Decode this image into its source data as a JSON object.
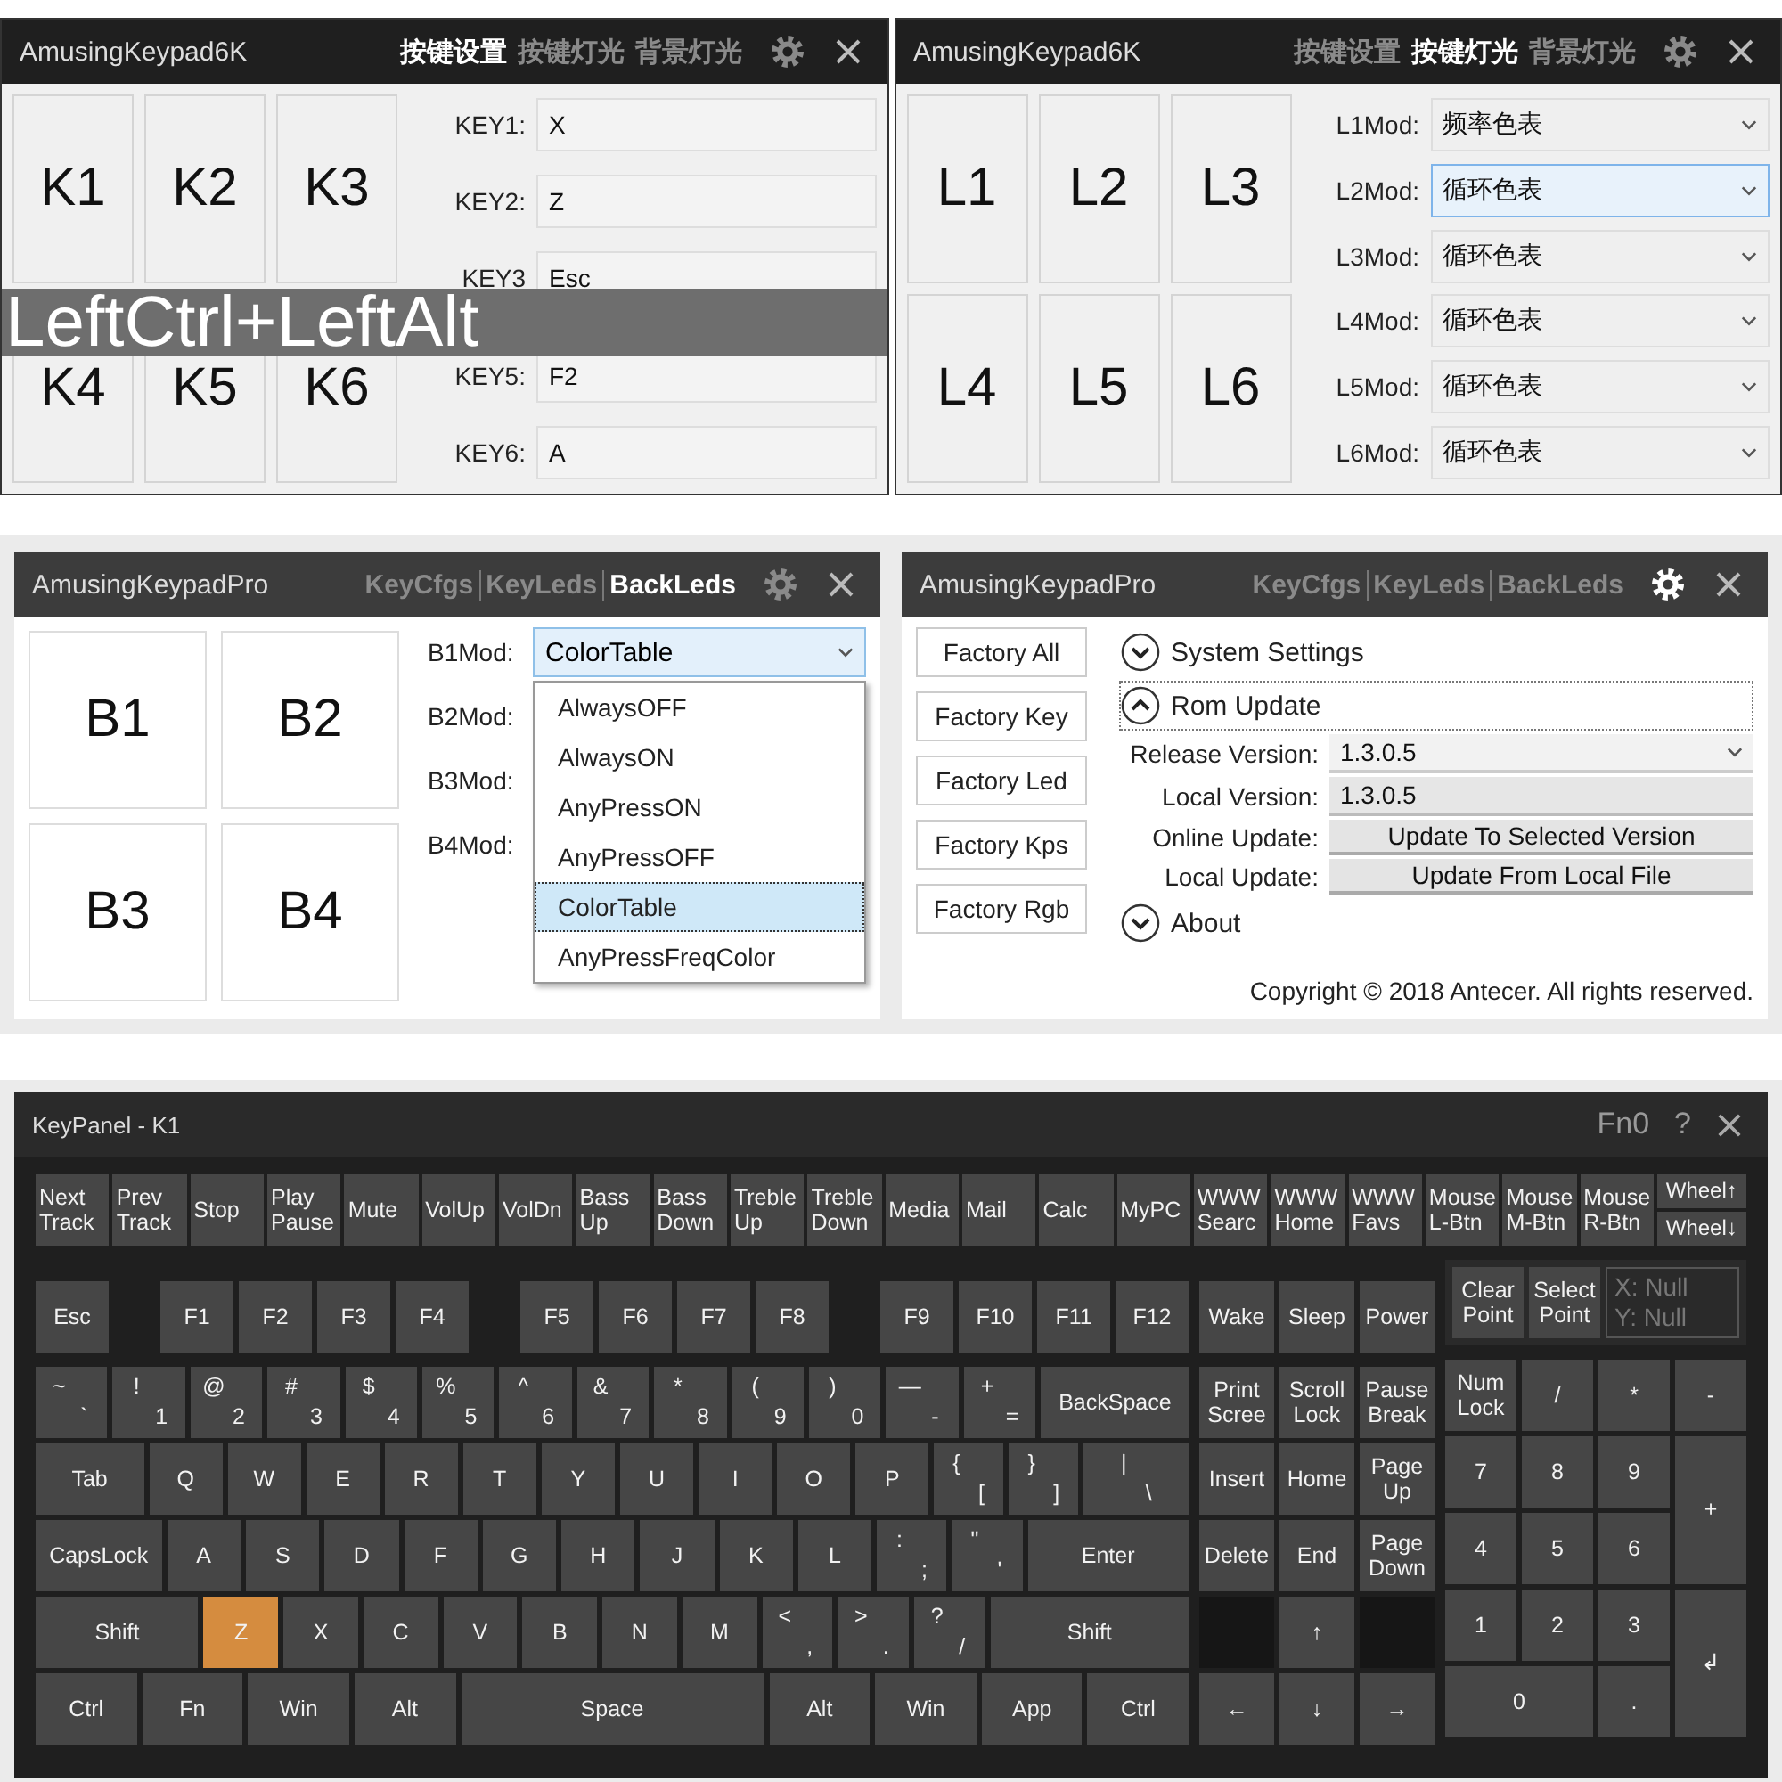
{
  "key_window": {
    "title": "AmusingKeypad6K",
    "settings_selected": false,
    "tabs": [
      {
        "label": "按键设置",
        "selected": true
      },
      {
        "label": "按键灯光",
        "selected": false
      },
      {
        "label": "背景灯光",
        "selected": false
      }
    ],
    "tiles": [
      "K1",
      "K2",
      "K3",
      "K4",
      "K5",
      "K6"
    ],
    "keys": [
      {
        "label": "KEY1:",
        "value": "X"
      },
      {
        "label": "KEY2:",
        "value": "Z"
      },
      {
        "label": "KEY3",
        "value": "Esc"
      },
      {
        "label": "KEY5:",
        "value": "F2"
      },
      {
        "label": "KEY6:",
        "value": "A"
      }
    ],
    "overlay": "LeftCtrl+LeftAlt"
  },
  "led_window": {
    "title": "AmusingKeypad6K",
    "settings_selected": false,
    "tabs": [
      {
        "label": "按键设置",
        "selected": false
      },
      {
        "label": "按键灯光",
        "selected": true
      },
      {
        "label": "背景灯光",
        "selected": false
      }
    ],
    "tiles": [
      "L1",
      "L2",
      "L3",
      "L4",
      "L5",
      "L6"
    ],
    "mods": [
      {
        "label": "L1Mod:",
        "value": "频率色表",
        "focused": false
      },
      {
        "label": "L2Mod:",
        "value": "循环色表",
        "focused": true
      },
      {
        "label": "L3Mod:",
        "value": "循环色表",
        "focused": false
      },
      {
        "label": "L4Mod:",
        "value": "循环色表",
        "focused": false
      },
      {
        "label": "L5Mod:",
        "value": "循环色表",
        "focused": false
      },
      {
        "label": "L6Mod:",
        "value": "循环色表",
        "focused": false
      }
    ]
  },
  "backled_window": {
    "title": "AmusingKeypadPro",
    "settings_selected": false,
    "tabs": [
      {
        "label": "KeyCfgs",
        "selected": false
      },
      {
        "label": "KeyLeds",
        "selected": false
      },
      {
        "label": "BackLeds",
        "selected": true
      }
    ],
    "tiles": [
      "B1",
      "B2",
      "B3",
      "B4"
    ],
    "mods": [
      {
        "label": "B1Mod:",
        "value": "ColorTable"
      },
      {
        "label": "B2Mod:"
      },
      {
        "label": "B3Mod:"
      },
      {
        "label": "B4Mod:"
      }
    ],
    "dropdown": [
      {
        "label": "AlwaysOFF",
        "selected": false
      },
      {
        "label": "AlwaysON",
        "selected": false
      },
      {
        "label": "AnyPressON",
        "selected": false
      },
      {
        "label": "AnyPressOFF",
        "selected": false
      },
      {
        "label": "ColorTable",
        "selected": true
      },
      {
        "label": "AnyPressFreqColor",
        "selected": false
      }
    ]
  },
  "settings_window": {
    "title": "AmusingKeypadPro",
    "settings_selected": true,
    "tabs": [
      {
        "label": "KeyCfgs",
        "selected": false
      },
      {
        "label": "KeyLeds",
        "selected": false
      },
      {
        "label": "BackLeds",
        "selected": false
      }
    ],
    "factory_buttons": [
      "Factory All",
      "Factory Key",
      "Factory Led",
      "Factory Kps",
      "Factory Rgb"
    ],
    "sections": [
      {
        "title": "System Settings",
        "expanded": false,
        "focused": false
      },
      {
        "title": "Rom Update",
        "expanded": true,
        "focused": true,
        "rows": [
          {
            "kind": "select",
            "label": "Release Version:",
            "value": "1.3.0.5"
          },
          {
            "kind": "field",
            "label": "Local Version:",
            "value": "1.3.0.5"
          },
          {
            "kind": "button",
            "label": "Online Update:",
            "value": "Update To Selected Version"
          },
          {
            "kind": "button",
            "label": "Local Update:",
            "value": "Update From Local File"
          }
        ]
      },
      {
        "title": "About",
        "expanded": false,
        "focused": false
      }
    ],
    "copyright": "Copyright ©  2018 Antecer. All rights reserved."
  },
  "keyboard": {
    "title": "KeyPanel - K1",
    "fn_layer": "Fn0",
    "help": "?",
    "media_keys": [
      {
        "lines": [
          "Next",
          "Track"
        ]
      },
      {
        "lines": [
          "Prev",
          "Track"
        ]
      },
      {
        "lines": [
          "Stop"
        ]
      },
      {
        "lines": [
          "Play",
          "Pause"
        ]
      },
      {
        "lines": [
          "Mute"
        ]
      },
      {
        "lines": [
          "VolUp"
        ]
      },
      {
        "lines": [
          "VolDn"
        ]
      },
      {
        "lines": [
          "Bass",
          "Up"
        ]
      },
      {
        "lines": [
          "Bass",
          "Down"
        ]
      },
      {
        "lines": [
          "Treble",
          "Up"
        ]
      },
      {
        "lines": [
          "Treble",
          "Down"
        ]
      },
      {
        "lines": [
          "Media"
        ]
      },
      {
        "lines": [
          "Mail"
        ]
      },
      {
        "lines": [
          "Calc"
        ]
      },
      {
        "lines": [
          "MyPC"
        ]
      },
      {
        "lines": [
          "WWW",
          "Searc"
        ]
      },
      {
        "lines": [
          "WWW",
          "Home"
        ]
      },
      {
        "lines": [
          "WWW",
          "Favs"
        ]
      },
      {
        "lines": [
          "Mouse",
          "L-Btn"
        ]
      },
      {
        "lines": [
          "Mouse",
          "M-Btn"
        ]
      },
      {
        "lines": [
          "Mouse",
          "R-Btn"
        ]
      }
    ],
    "wheel_keys": [
      "Wheel↑",
      "Wheel↓"
    ],
    "f_groups": [
      {
        "keys": [
          {
            "label": "Esc",
            "selected": false
          }
        ]
      },
      {
        "keys": [
          {
            "label": "F1",
            "selected": false
          },
          {
            "label": "F2",
            "selected": false
          },
          {
            "label": "F3",
            "selected": false
          },
          {
            "label": "F4",
            "selected": false
          }
        ]
      },
      {
        "keys": [
          {
            "label": "F5",
            "selected": false
          },
          {
            "label": "F6",
            "selected": false
          },
          {
            "label": "F7",
            "selected": false
          },
          {
            "label": "F8",
            "selected": false
          }
        ]
      },
      {
        "keys": [
          {
            "label": "F9",
            "selected": false
          },
          {
            "label": "F10",
            "selected": false
          },
          {
            "label": "F11",
            "selected": false
          },
          {
            "label": "F12",
            "selected": false
          }
        ]
      }
    ],
    "main_rows": [
      {
        "keys": [
          {
            "upper": "~",
            "lower": "`",
            "selected": false
          },
          {
            "upper": "!",
            "lower": "1",
            "selected": false
          },
          {
            "upper": "@",
            "lower": "2",
            "selected": false
          },
          {
            "upper": "#",
            "lower": "3",
            "selected": false
          },
          {
            "upper": "$",
            "lower": "4",
            "selected": false
          },
          {
            "upper": "%",
            "lower": "5",
            "selected": false
          },
          {
            "upper": "^",
            "lower": "6",
            "selected": false
          },
          {
            "upper": "&",
            "lower": "7",
            "selected": false
          },
          {
            "upper": "*",
            "lower": "8",
            "selected": false
          },
          {
            "upper": "(",
            "lower": "9",
            "selected": false
          },
          {
            "upper": ")",
            "lower": "0",
            "selected": false
          },
          {
            "upper": "—",
            "lower": "-",
            "selected": false
          },
          {
            "upper": "+",
            "lower": "=",
            "selected": false
          },
          {
            "label": "BackSpace",
            "selected": false
          }
        ]
      },
      {
        "keys": [
          {
            "label": "Tab",
            "selected": false
          },
          {
            "label": "Q",
            "selected": false
          },
          {
            "label": "W",
            "selected": false
          },
          {
            "label": "E",
            "selected": false
          },
          {
            "label": "R",
            "selected": false
          },
          {
            "label": "T",
            "selected": false
          },
          {
            "label": "Y",
            "selected": false
          },
          {
            "label": "U",
            "selected": false
          },
          {
            "label": "I",
            "selected": false
          },
          {
            "label": "O",
            "selected": false
          },
          {
            "label": "P",
            "selected": false
          },
          {
            "upper": "{",
            "lower": "[",
            "selected": false
          },
          {
            "upper": "}",
            "lower": "]",
            "selected": false
          },
          {
            "upper": "|",
            "lower": "\\",
            "selected": false
          }
        ]
      },
      {
        "keys": [
          {
            "label": "CapsLock",
            "selected": false
          },
          {
            "label": "A",
            "selected": false
          },
          {
            "label": "S",
            "selected": false
          },
          {
            "label": "D",
            "selected": false
          },
          {
            "label": "F",
            "selected": false
          },
          {
            "label": "G",
            "selected": false
          },
          {
            "label": "H",
            "selected": false
          },
          {
            "label": "J",
            "selected": false
          },
          {
            "label": "K",
            "selected": false
          },
          {
            "label": "L",
            "selected": false
          },
          {
            "upper": ":",
            "lower": ";",
            "selected": false
          },
          {
            "upper": "\"",
            "lower": "'",
            "selected": false
          },
          {
            "label": "Enter",
            "selected": false
          }
        ]
      },
      {
        "keys": [
          {
            "label": "Shift",
            "selected": false
          },
          {
            "label": "Z",
            "selected": true
          },
          {
            "label": "X",
            "selected": false
          },
          {
            "label": "C",
            "selected": false
          },
          {
            "label": "V",
            "selected": false
          },
          {
            "label": "B",
            "selected": false
          },
          {
            "label": "N",
            "selected": false
          },
          {
            "label": "M",
            "selected": false
          },
          {
            "upper": "<",
            "lower": ",",
            "selected": false
          },
          {
            "upper": ">",
            "lower": ".",
            "selected": false
          },
          {
            "upper": "?",
            "lower": "/",
            "selected": false
          },
          {
            "label": "Shift",
            "selected": false
          }
        ]
      },
      {
        "keys": [
          {
            "label": "Ctrl",
            "selected": false
          },
          {
            "label": "Fn",
            "selected": false
          },
          {
            "label": "Win",
            "selected": false
          },
          {
            "label": "Alt",
            "selected": false
          },
          {
            "label": "Space",
            "selected": false
          },
          {
            "label": "Alt",
            "selected": false
          },
          {
            "label": "Win",
            "selected": false
          },
          {
            "label": "App",
            "selected": false
          },
          {
            "label": "Ctrl",
            "selected": false
          }
        ]
      }
    ],
    "nav_top": [
      {
        "label": "Wake",
        "selected": false
      },
      {
        "label": "Sleep",
        "selected": false
      },
      {
        "label": "Power",
        "selected": false
      }
    ],
    "nav_keys": [
      {
        "kind": "key",
        "lines": [
          "Print",
          "Scree"
        ],
        "selected": false
      },
      {
        "kind": "key",
        "lines": [
          "Scroll",
          "Lock"
        ],
        "selected": false
      },
      {
        "kind": "key",
        "lines": [
          "Pause",
          "Break"
        ],
        "selected": false
      },
      {
        "kind": "key",
        "lines": [
          "Insert"
        ],
        "selected": false
      },
      {
        "kind": "key",
        "lines": [
          "Home"
        ],
        "selected": false
      },
      {
        "kind": "key",
        "lines": [
          "Page",
          "Up"
        ],
        "selected": false
      },
      {
        "kind": "key",
        "lines": [
          "Delete"
        ],
        "selected": false
      },
      {
        "kind": "key",
        "lines": [
          "End"
        ],
        "selected": false
      },
      {
        "kind": "key",
        "lines": [
          "Page",
          "Down"
        ],
        "selected": false
      },
      {
        "kind": "blank"
      },
      {
        "kind": "key",
        "lines": [
          "↑"
        ],
        "selected": false
      },
      {
        "kind": "blank"
      },
      {
        "kind": "key",
        "lines": [
          "←"
        ],
        "selected": false
      },
      {
        "kind": "key",
        "lines": [
          "↓"
        ],
        "selected": false
      },
      {
        "kind": "key",
        "lines": [
          "→"
        ],
        "selected": false
      }
    ],
    "point_buttons": [
      {
        "lines": [
          "Clear",
          "Point"
        ]
      },
      {
        "lines": [
          "Select",
          "Point"
        ]
      }
    ],
    "coords": [
      "X: Null",
      "Y: Null"
    ],
    "numpad": [
      {
        "kind": "key",
        "lines": [
          "Num",
          "Lock"
        ],
        "selected": false
      },
      {
        "kind": "key",
        "lines": [
          "/"
        ],
        "selected": false
      },
      {
        "kind": "key",
        "lines": [
          "*"
        ],
        "selected": false
      },
      {
        "kind": "key",
        "lines": [
          "-"
        ],
        "selected": false
      },
      {
        "kind": "key",
        "lines": [
          "7"
        ],
        "selected": false
      },
      {
        "kind": "key",
        "lines": [
          "8"
        ],
        "selected": false
      },
      {
        "kind": "key",
        "lines": [
          "9"
        ],
        "selected": false
      },
      {
        "kind": "tall",
        "lines": [
          "+"
        ],
        "selected": false
      },
      {
        "kind": "key",
        "lines": [
          "4"
        ],
        "selected": false
      },
      {
        "kind": "key",
        "lines": [
          "5"
        ],
        "selected": false
      },
      {
        "kind": "key",
        "lines": [
          "6"
        ],
        "selected": false
      },
      {
        "kind": "key",
        "lines": [
          "1"
        ],
        "selected": false
      },
      {
        "kind": "key",
        "lines": [
          "2"
        ],
        "selected": false
      },
      {
        "kind": "key",
        "lines": [
          "3"
        ],
        "selected": false
      },
      {
        "kind": "tall",
        "lines": [
          "↲"
        ],
        "selected": false
      },
      {
        "kind": "wide",
        "lines": [
          "0"
        ],
        "selected": false
      },
      {
        "kind": "key",
        "lines": [
          "."
        ],
        "selected": false
      }
    ]
  }
}
